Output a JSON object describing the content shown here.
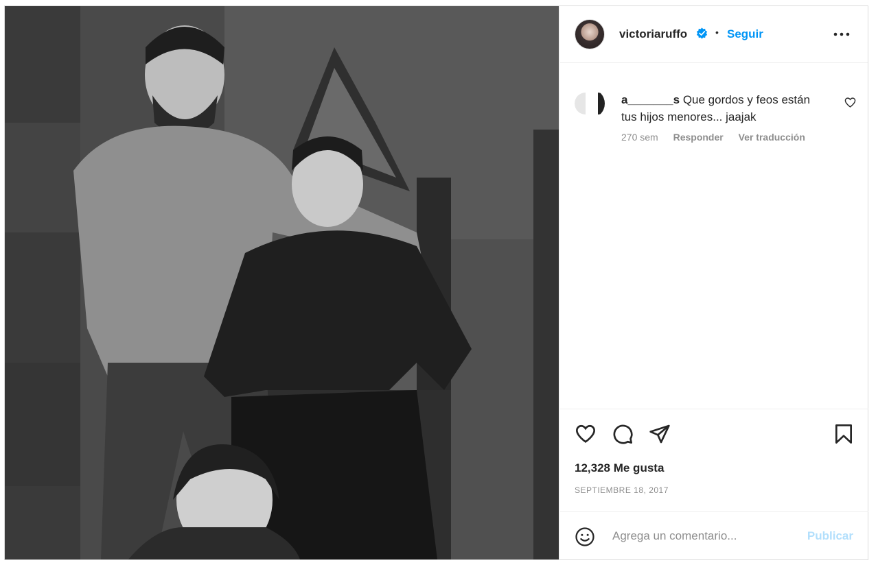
{
  "post": {
    "author": {
      "username": "victoriaruffo",
      "verified": true,
      "separator": "•",
      "follow_label": "Seguir",
      "more_icon": "more-horizontal-icon"
    },
    "photo": {
      "style": "black-and-white"
    },
    "comments": [
      {
        "username": "a_______s",
        "text": "Que gordos y feos están tus hijos menores... jaajak",
        "time": "270 sem",
        "reply_label": "Responder",
        "translate_label": "Ver traducción",
        "like_icon": "heart-outline-icon"
      }
    ],
    "actions": {
      "like_icon": "heart-outline-icon",
      "comment_icon": "comment-bubble-icon",
      "share_icon": "paper-plane-icon",
      "save_icon": "bookmark-icon"
    },
    "likes_text": "12,328 Me gusta",
    "date_text": "SEPTIEMBRE 18, 2017",
    "add_comment": {
      "placeholder": "Agrega un comentario...",
      "publish_label": "Publicar",
      "emoji_icon": "emoji-smile-icon"
    }
  },
  "colors": {
    "accent": "#0095f6",
    "publish_disabled": "#b2dffc",
    "secondary_text": "#8e8e8e",
    "border": "#dbdbdb"
  }
}
